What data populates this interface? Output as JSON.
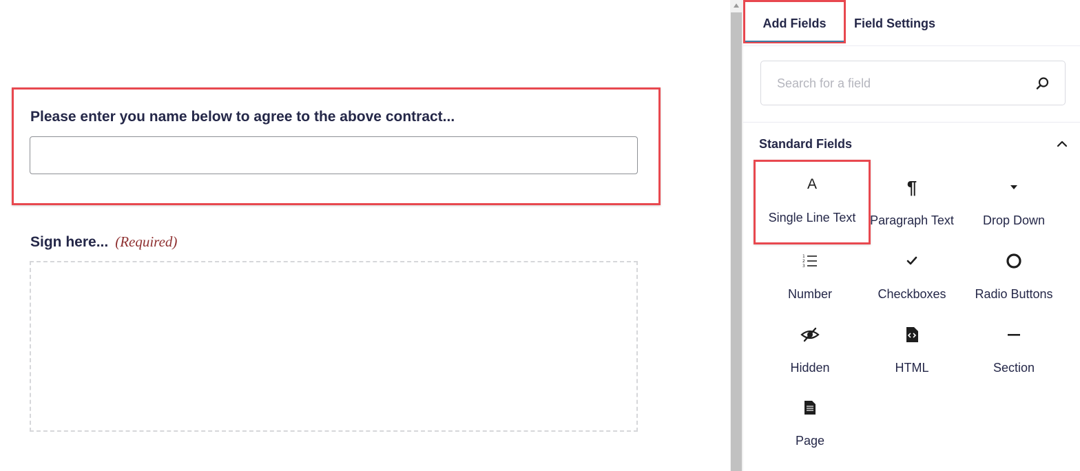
{
  "form": {
    "name_field_label": "Please enter you name below to agree to the above contract...",
    "name_field_value": "",
    "signature_label": "Sign here...",
    "signature_required": "(Required)"
  },
  "panel": {
    "tabs": [
      {
        "label": "Add Fields",
        "active": true
      },
      {
        "label": "Field Settings",
        "active": false
      }
    ],
    "search": {
      "placeholder": "Search for a field",
      "value": ""
    },
    "section": {
      "title": "Standard Fields",
      "expanded": true
    },
    "fields": [
      {
        "label": "Single Line Text",
        "icon": "text-icon",
        "glyph": "A"
      },
      {
        "label": "Paragraph Text",
        "icon": "paragraph-icon",
        "glyph": "¶"
      },
      {
        "label": "Drop Down",
        "icon": "dropdown-icon",
        "glyph": "▾"
      },
      {
        "label": "Number",
        "icon": "numbered-list-icon"
      },
      {
        "label": "Checkboxes",
        "icon": "checkmark-icon",
        "glyph": "✓"
      },
      {
        "label": "Radio Buttons",
        "icon": "radio-icon"
      },
      {
        "label": "Hidden",
        "icon": "eye-slash-icon"
      },
      {
        "label": "HTML",
        "icon": "html-file-icon"
      },
      {
        "label": "Section",
        "icon": "minus-icon"
      },
      {
        "label": "Page",
        "icon": "page-icon"
      }
    ]
  },
  "colors": {
    "highlight": "#e8484f",
    "text": "#242748",
    "required": "#8e2f2f",
    "active_tab_underline": "#3e7da6"
  }
}
